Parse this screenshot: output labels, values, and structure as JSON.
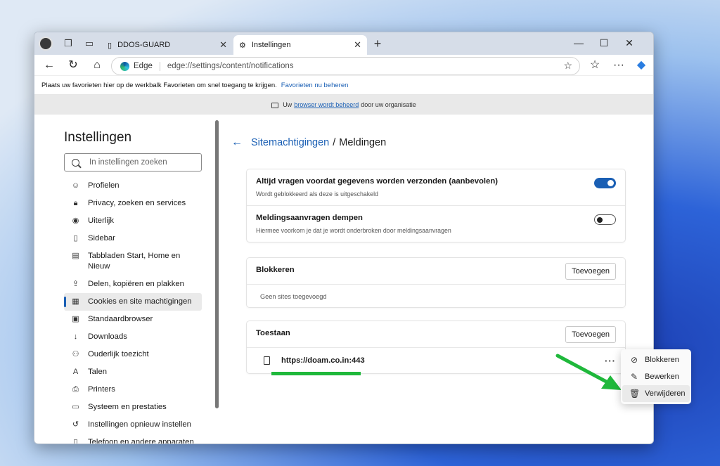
{
  "tabs": [
    {
      "title": "DDOS-GUARD",
      "close": "✕"
    },
    {
      "title": "Instellingen",
      "close": "✕"
    }
  ],
  "new_tab": "+",
  "window_controls": {
    "minimize": "—",
    "maximize": "☐",
    "close": "✕"
  },
  "address": {
    "chip": "Edge",
    "url": "edge://settings/content/notifications"
  },
  "favorites_bar": {
    "text": "Plaats uw favorieten hier op de werkbalk Favorieten om snel toegang te krijgen.",
    "link": "Favorieten nu beheren"
  },
  "managed_bar": {
    "prefix": "Uw",
    "link": "browser wordt beheerd",
    "suffix": "door uw organisatie"
  },
  "sidebar": {
    "title": "Instellingen",
    "search_placeholder": "In instellingen zoeken",
    "items": [
      {
        "label": "Profielen",
        "icon": "profile-icon"
      },
      {
        "label": "Privacy, zoeken en services",
        "icon": "lock-icon"
      },
      {
        "label": "Uiterlijk",
        "icon": "appearance-icon"
      },
      {
        "label": "Sidebar",
        "icon": "sidebar-icon"
      },
      {
        "label": "Tabbladen Start, Home en Nieuw",
        "icon": "tabs-icon"
      },
      {
        "label": "Delen, kopiëren en plakken",
        "icon": "share-icon"
      },
      {
        "label": "Cookies en site machtigingen",
        "icon": "cookies-icon"
      },
      {
        "label": "Standaardbrowser",
        "icon": "browser-icon"
      },
      {
        "label": "Downloads",
        "icon": "download-icon"
      },
      {
        "label": "Ouderlijk toezicht",
        "icon": "family-icon"
      },
      {
        "label": "Talen",
        "icon": "language-icon"
      },
      {
        "label": "Printers",
        "icon": "printer-icon"
      },
      {
        "label": "Systeem en prestaties",
        "icon": "system-icon"
      },
      {
        "label": "Instellingen opnieuw instellen",
        "icon": "reset-icon"
      },
      {
        "label": "Telefoon en andere apparaten",
        "icon": "phone-icon"
      }
    ]
  },
  "breadcrumb": {
    "parent": "Sitemachtigingen",
    "separator": "/",
    "current": "Meldingen"
  },
  "settings": {
    "ask": {
      "title": "Altijd vragen voordat gegevens worden verzonden (aanbevolen)",
      "desc": "Wordt geblokkeerd als deze is uitgeschakeld",
      "on": true
    },
    "quiet": {
      "title": "Meldingsaanvragen dempen",
      "desc": "Hiermee voorkom je dat je wordt onderbroken door meldingsaanvragen",
      "on": false
    }
  },
  "block": {
    "title": "Blokkeren",
    "add": "Toevoegen",
    "empty": "Geen sites toegevoegd"
  },
  "allow": {
    "title": "Toestaan",
    "add": "Toevoegen",
    "site": "https://doam.co.in:443",
    "more": "···"
  },
  "context_menu": [
    {
      "label": "Blokkeren",
      "icon": "block-icon"
    },
    {
      "label": "Bewerken",
      "icon": "pencil-icon"
    },
    {
      "label": "Verwijderen",
      "icon": "trash-icon"
    }
  ],
  "colors": {
    "accent": "#1a5fb4",
    "annotation": "#1fb83b"
  }
}
